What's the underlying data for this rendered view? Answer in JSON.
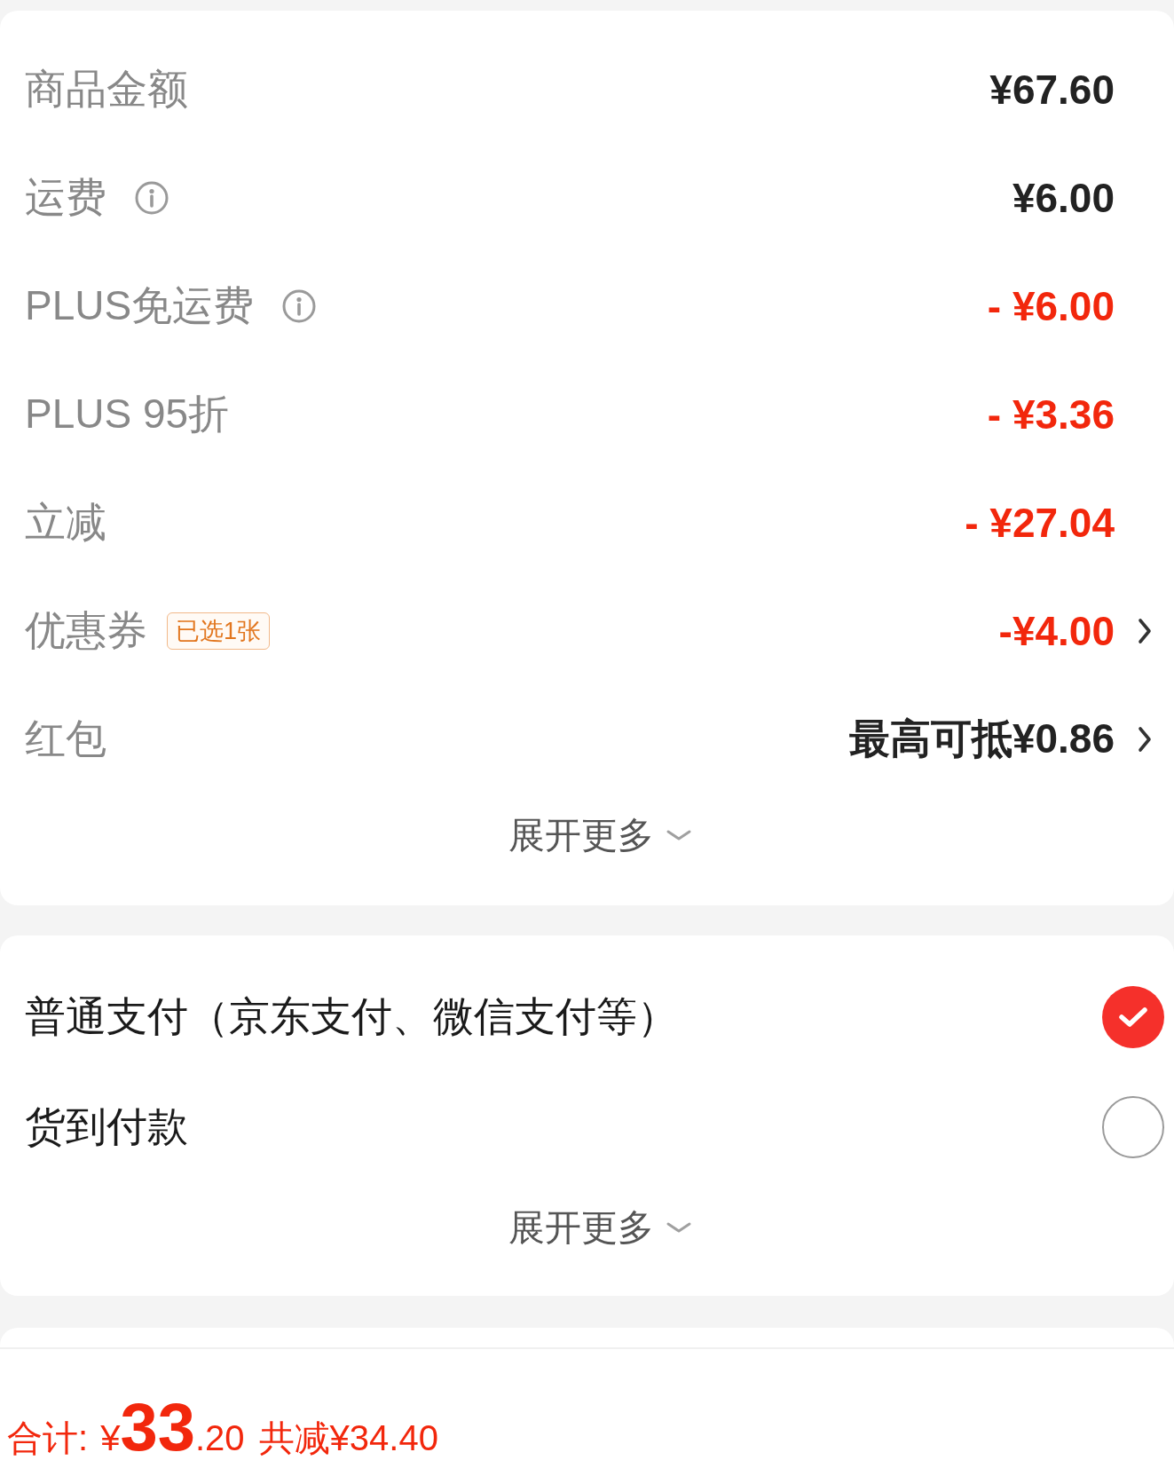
{
  "price_details": {
    "rows": [
      {
        "label": "商品金额",
        "info": false,
        "value": "¥67.60",
        "discount": false,
        "link": false
      },
      {
        "label": "运费",
        "info": true,
        "value": "¥6.00",
        "discount": false,
        "link": false
      },
      {
        "label": "PLUS免运费",
        "info": true,
        "value": "- ¥6.00",
        "discount": true,
        "link": false
      },
      {
        "label": "PLUS 95折",
        "info": false,
        "value": "- ¥3.36",
        "discount": true,
        "link": false
      },
      {
        "label": "立减",
        "info": false,
        "value": "- ¥27.04",
        "discount": true,
        "link": false
      },
      {
        "label": "优惠券",
        "info": false,
        "badge": "已选1张",
        "value": "-¥4.00",
        "discount": true,
        "link": true
      },
      {
        "label": "红包",
        "info": false,
        "value": "最高可抵¥0.86",
        "discount": false,
        "link": true
      }
    ],
    "expand": {
      "label": "展开更多"
    }
  },
  "payment": {
    "options": [
      {
        "label": "普通支付（京东支付、微信支付等）",
        "selected": true
      },
      {
        "label": "货到付款",
        "selected": false
      }
    ],
    "expand": {
      "label": "展开更多"
    }
  },
  "total_bar": {
    "label": "合计:",
    "currency": "¥",
    "integer": "33",
    "decimal": ".20",
    "saved": "共减¥34.40"
  }
}
